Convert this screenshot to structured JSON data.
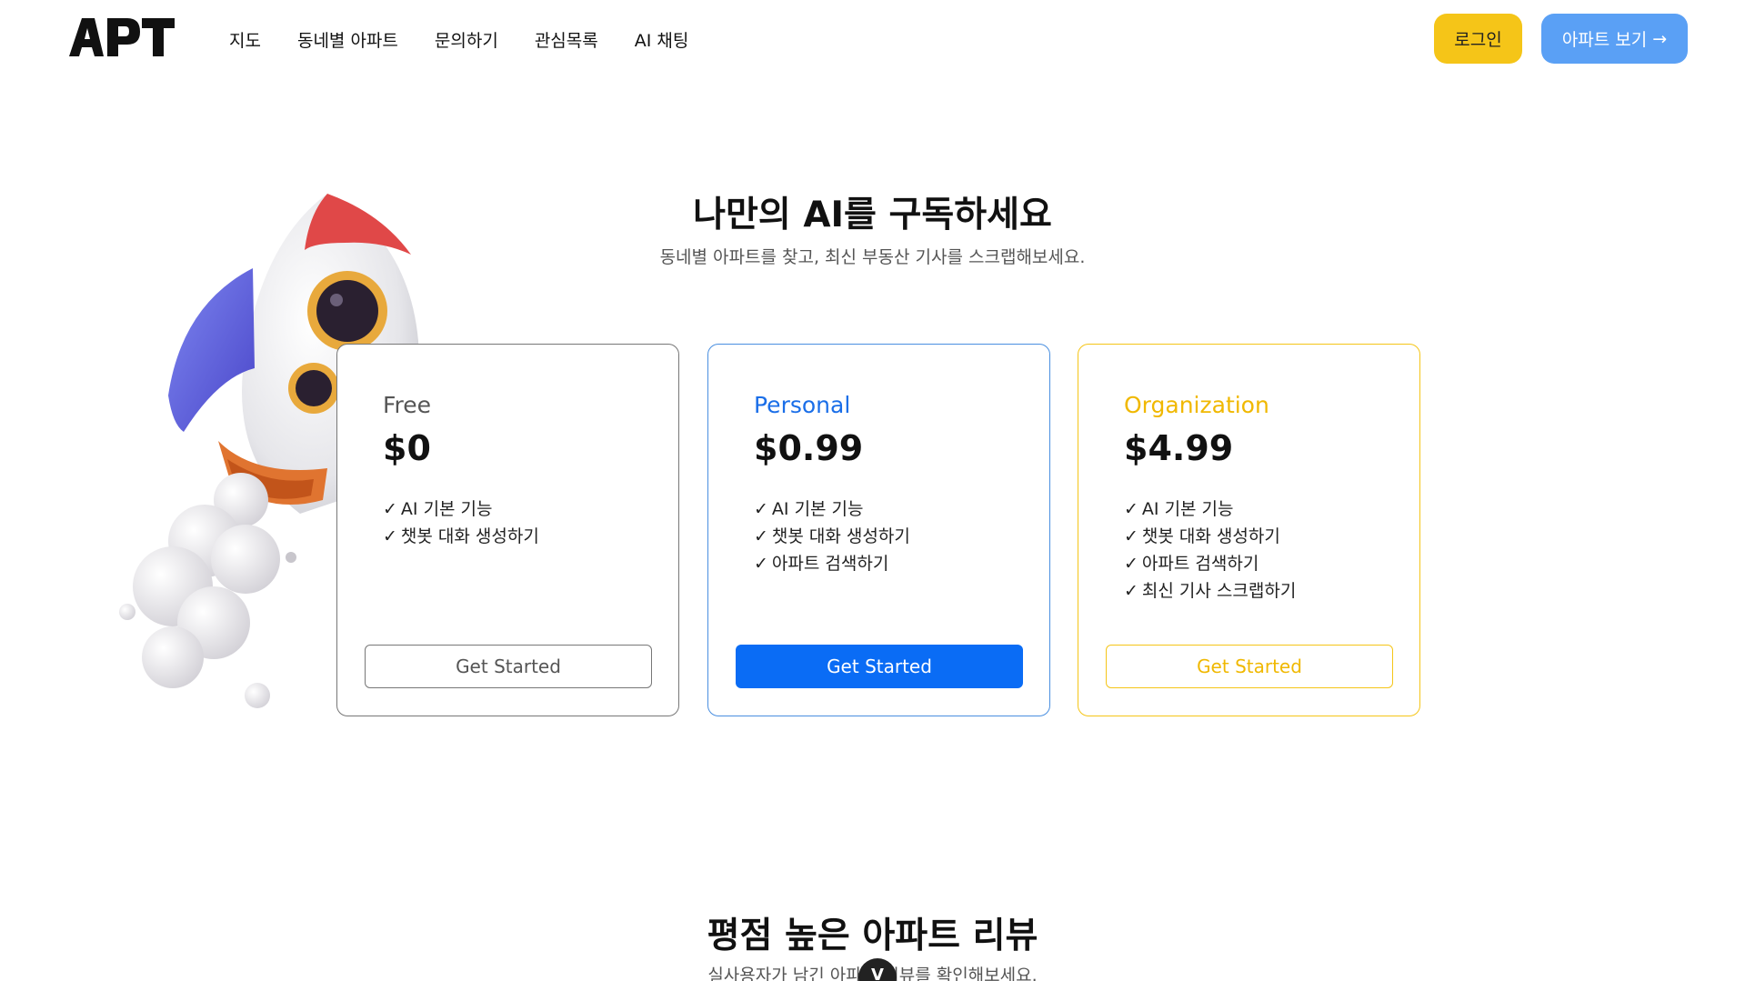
{
  "header": {
    "logo_text": "APT",
    "nav": [
      "지도",
      "동네별 아파트",
      "문의하기",
      "관심목록",
      "AI 채팅"
    ],
    "login_label": "로그인",
    "apt_label": "아파트 보기",
    "apt_arrow": "→"
  },
  "hero": {
    "title": "나만의 AI를 구독하세요",
    "subtitle": "동네별 아파트를 찾고, 최신 부동산 기사를 스크랩해보세요."
  },
  "plans": [
    {
      "name": "Free",
      "price": "$0",
      "features": [
        "AI 기본 기능",
        "챗봇 대화 생성하기"
      ],
      "button": "Get Started"
    },
    {
      "name": "Personal",
      "price": "$0.99",
      "features": [
        "AI 기본 기능",
        "챗봇 대화 생성하기",
        "아파트 검색하기"
      ],
      "button": "Get Started"
    },
    {
      "name": "Organization",
      "price": "$4.99",
      "features": [
        "AI 기본 기능",
        "챗봇 대화 생성하기",
        "아파트 검색하기",
        "최신 기사 스크랩하기"
      ],
      "button": "Get Started"
    }
  ],
  "checkmark": "✓",
  "reviews": {
    "title": "평점 높은 아파트 리뷰",
    "subtitle": "실사용자가 남긴 아파트 리뷰를 확인해보세요.",
    "scroll_icon": "V"
  },
  "colors": {
    "login_bg": "#f5c518",
    "apt_bg": "#5aa0f5",
    "personal_accent": "#0a6cf5",
    "org_accent": "#f5c518"
  }
}
